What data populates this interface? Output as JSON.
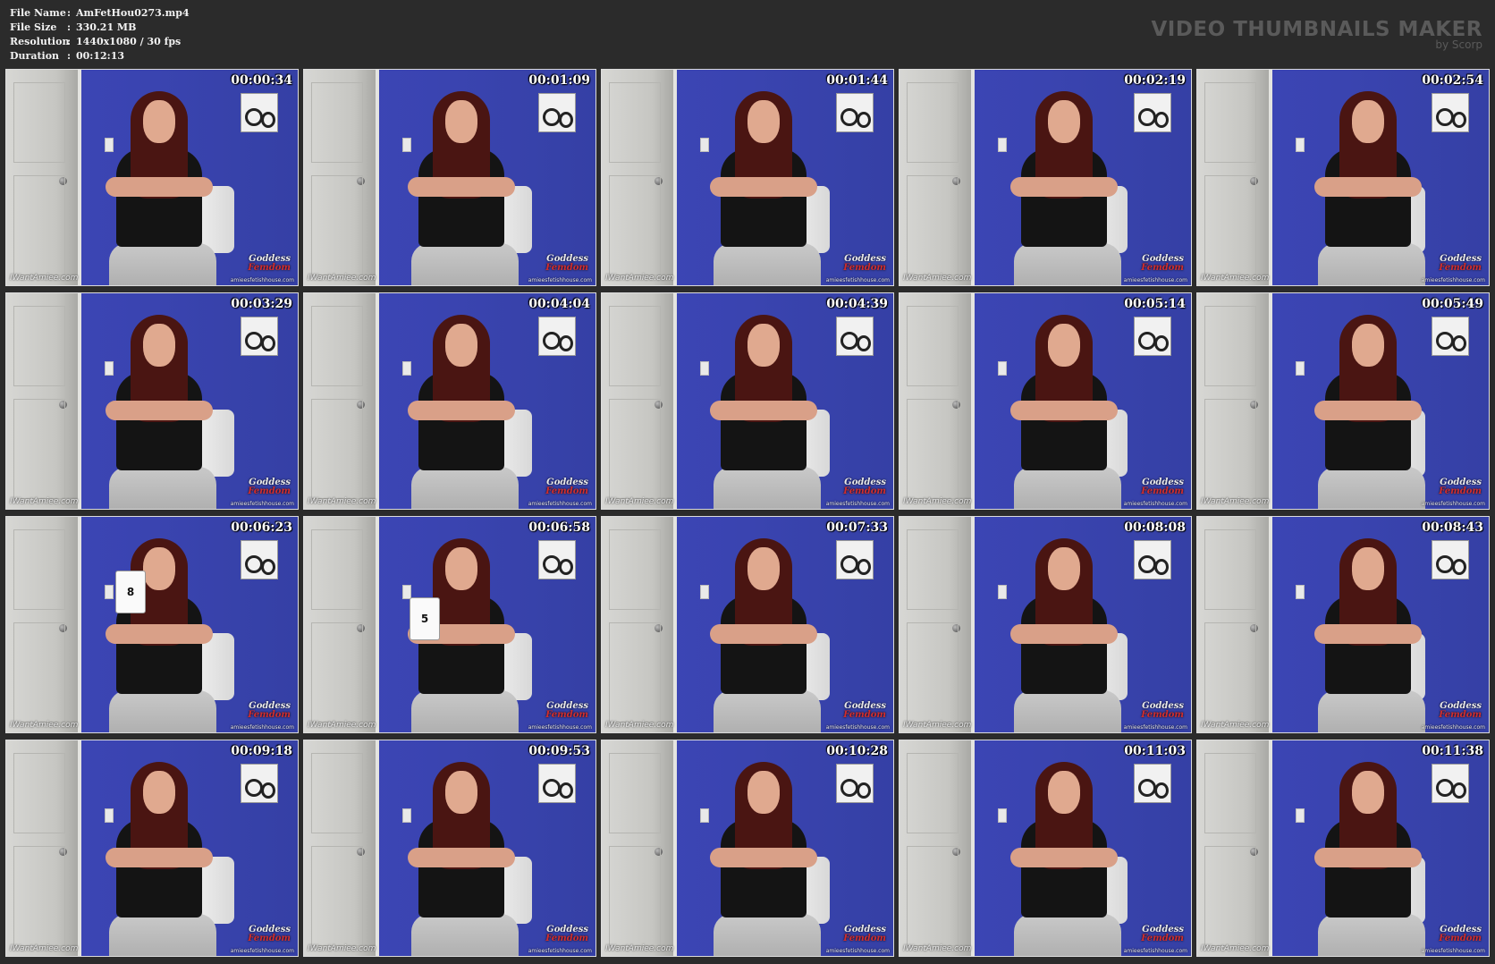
{
  "header": {
    "fields": [
      {
        "label": "File Name",
        "sep": ":",
        "value": "AmFetHou0273.mp4"
      },
      {
        "label": "File Size",
        "sep": ":",
        "value": "330.21 MB"
      },
      {
        "label": "Resolution",
        "sep": ":",
        "value": "1440x1080 / 30 fps"
      },
      {
        "label": "Duration",
        "sep": ":",
        "value": "00:12:13"
      }
    ],
    "brand_title": "VIDEO THUMBNAILS MAKER",
    "brand_sub": "by Scorp"
  },
  "watermarks": {
    "left": "IWantAmiee.com",
    "logo_line1": "Goddess",
    "logo_line2": "Femdom",
    "right": "amieesfetishhouse.com"
  },
  "thumbnails": [
    {
      "time": "00:00:34",
      "card": ""
    },
    {
      "time": "00:01:09",
      "card": ""
    },
    {
      "time": "00:01:44",
      "card": ""
    },
    {
      "time": "00:02:19",
      "card": ""
    },
    {
      "time": "00:02:54",
      "card": ""
    },
    {
      "time": "00:03:29",
      "card": ""
    },
    {
      "time": "00:04:04",
      "card": ""
    },
    {
      "time": "00:04:39",
      "card": ""
    },
    {
      "time": "00:05:14",
      "card": ""
    },
    {
      "time": "00:05:49",
      "card": ""
    },
    {
      "time": "00:06:23",
      "card": "8"
    },
    {
      "time": "00:06:58",
      "card": "5"
    },
    {
      "time": "00:07:33",
      "card": ""
    },
    {
      "time": "00:08:08",
      "card": ""
    },
    {
      "time": "00:08:43",
      "card": ""
    },
    {
      "time": "00:09:18",
      "card": ""
    },
    {
      "time": "00:09:53",
      "card": ""
    },
    {
      "time": "00:10:28",
      "card": ""
    },
    {
      "time": "00:11:03",
      "card": ""
    },
    {
      "time": "00:11:38",
      "card": ""
    }
  ]
}
